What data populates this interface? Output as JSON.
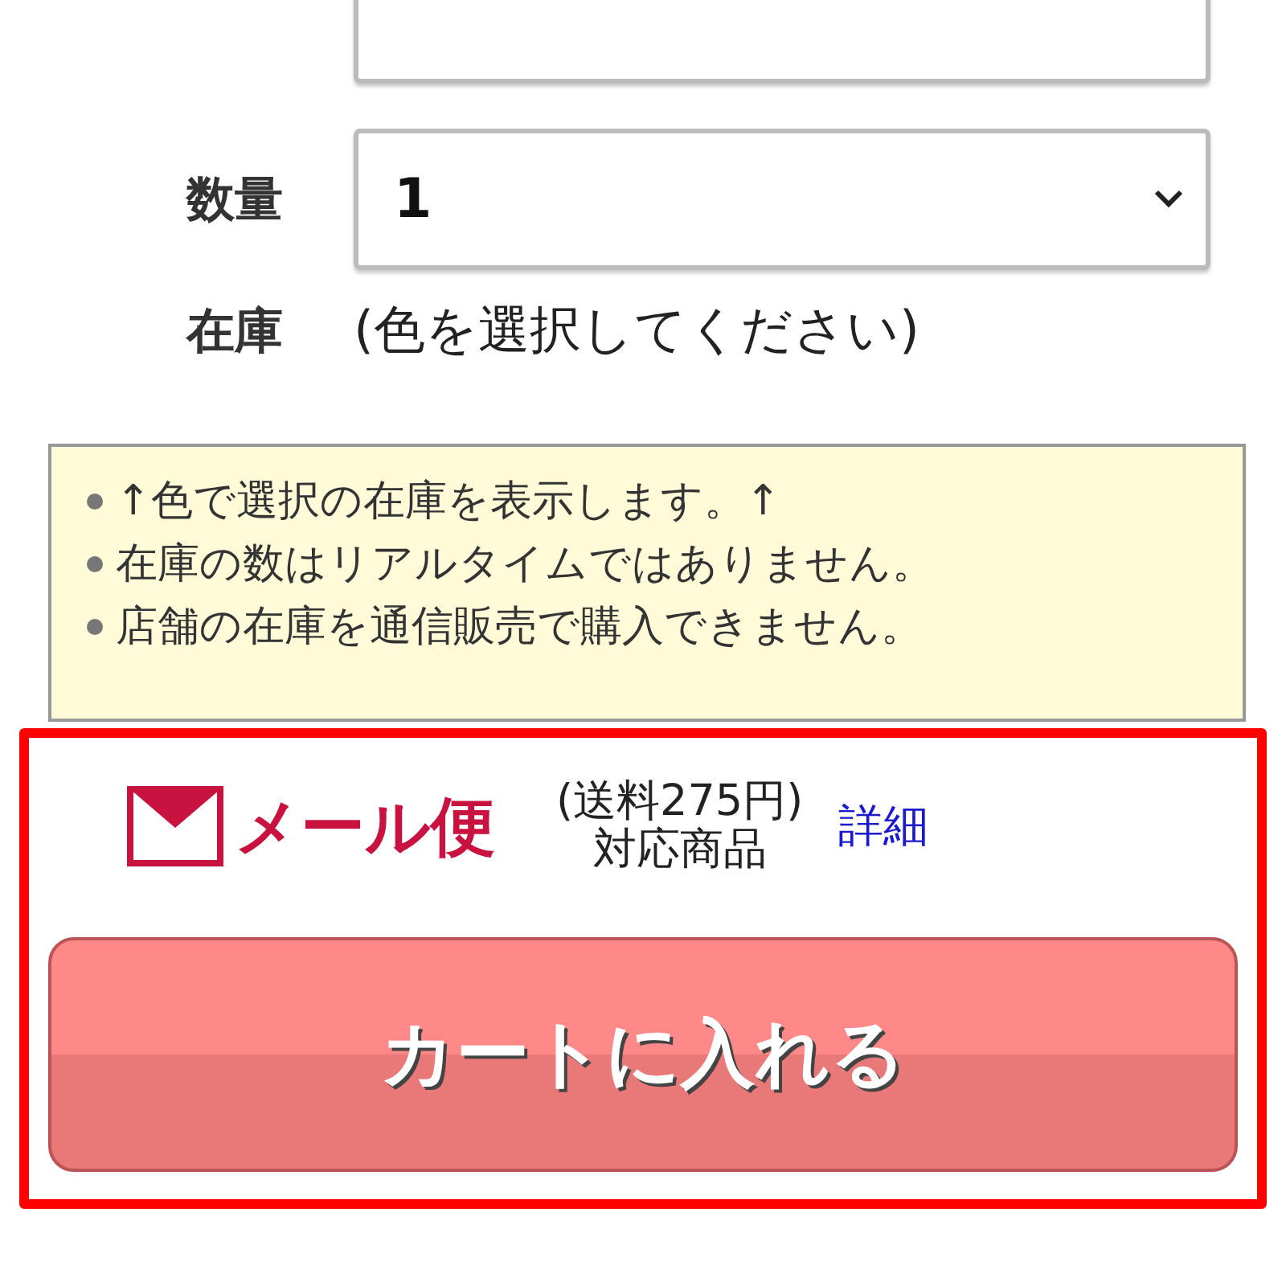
{
  "fields": [
    {
      "kind": "cut"
    },
    {
      "kind": "full",
      "label": "数量",
      "value": "1"
    }
  ],
  "stock": {
    "label": "在庫",
    "value": "(色を選択してください)"
  },
  "notes": [
    "↑色で選択の在庫を表示します。↑",
    "在庫の数はリアルタイムではありません。",
    "店舗の在庫を通信販売で購入できません。"
  ],
  "mail": {
    "logo": "メール便",
    "fee": "(送料275円)",
    "sub": "対応商品",
    "link": "詳細"
  },
  "cart_button": "カートに入れる"
}
